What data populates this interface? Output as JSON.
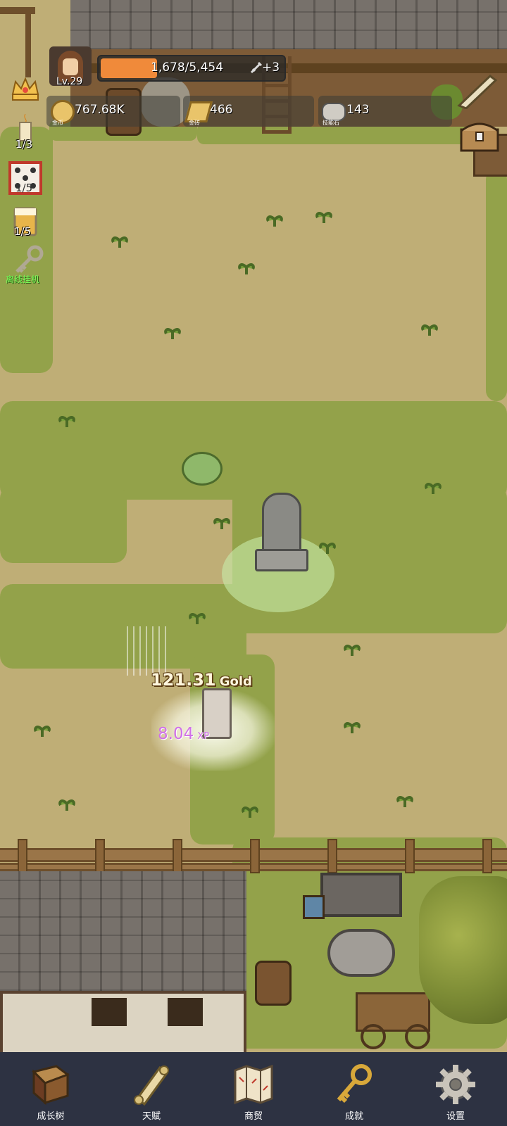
{
  "player": {
    "level": "Lv.29",
    "xp_text": "1,678/5,454",
    "xp_progress": 0.31,
    "bonus": "+3"
  },
  "currencies": [
    {
      "name": "coin-icon",
      "value": "767.68K",
      "label": "金币"
    },
    {
      "name": "gold-bar-icon",
      "value": "466",
      "label": "金砖"
    },
    {
      "name": "skill-stone-icon",
      "value": "143",
      "label": "技能石"
    }
  ],
  "side_counters": {
    "candle": "1/3",
    "dice": "1/5",
    "beer": "1/5"
  },
  "auto_idle_label": "离线挂机",
  "floating": {
    "gold_value": "121.31",
    "gold_unit": "Gold",
    "xp_value": "8.04",
    "xp_unit": "XP"
  },
  "nav": [
    {
      "label": "成长树",
      "icon": "book-icon"
    },
    {
      "label": "天赋",
      "icon": "scroll-icon"
    },
    {
      "label": "商贸",
      "icon": "map-icon"
    },
    {
      "label": "成就",
      "icon": "key-icon"
    },
    {
      "label": "设置",
      "icon": "gear-icon"
    }
  ],
  "colors": {
    "xp_bar": "#f08a3a",
    "nav_bg": "#2d3242",
    "grass": "#93a24a",
    "dirt": "#bfae76"
  }
}
